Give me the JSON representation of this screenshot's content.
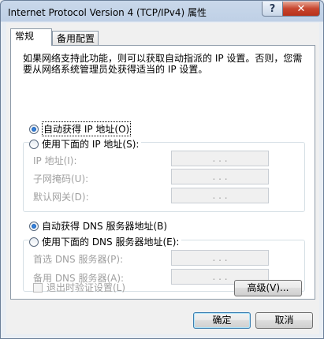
{
  "window": {
    "title": "Internet Protocol Version 4 (TCP/IPv4) 属性",
    "help_glyph": "?",
    "close_glyph": "✕"
  },
  "tabs": [
    {
      "label": "常规",
      "active": true
    },
    {
      "label": "备用配置",
      "active": false
    }
  ],
  "description": "如果网络支持此功能，则可以获取自动指派的 IP 设置。否则，您需要从网络系统管理员处获得适当的 IP 设置。",
  "ip": {
    "auto_label": "自动获得 IP 地址(O)",
    "manual_label": "使用下面的 IP 地址(S):",
    "fields": [
      {
        "label": "IP 地址(I):",
        "value": ".   .   ."
      },
      {
        "label": "子网掩码(U):",
        "value": ".   .   ."
      },
      {
        "label": "默认网关(D):",
        "value": ".   .   ."
      }
    ]
  },
  "dns": {
    "auto_label": "自动获得 DNS 服务器地址(B)",
    "manual_label": "使用下面的 DNS 服务器地址(E):",
    "fields": [
      {
        "label": "首选 DNS 服务器(P):",
        "value": ".   .   ."
      },
      {
        "label": "备用 DNS 服务器(A):",
        "value": ".   .   ."
      }
    ]
  },
  "validate_label": "退出时验证设置(L)",
  "buttons": {
    "advanced": "高级(V)...",
    "ok": "确定",
    "cancel": "取消"
  }
}
